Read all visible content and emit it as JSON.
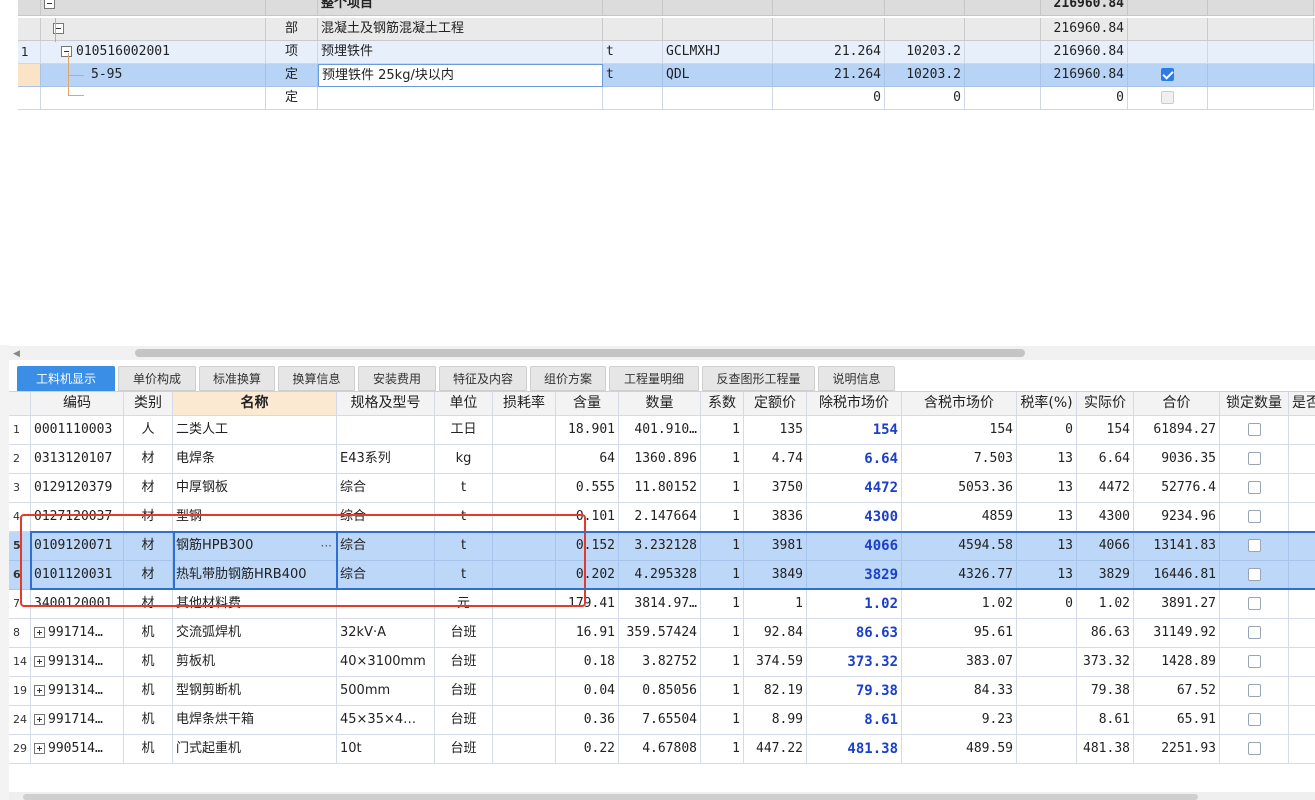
{
  "upper": {
    "rows": [
      {
        "kind": "head",
        "name": "整个项目",
        "total": "216960.84"
      },
      {
        "kind": "part",
        "type": "部",
        "name": "混凝土及钢筋混凝土工程",
        "total": "216960.84"
      },
      {
        "kind": "item",
        "idx": "1",
        "code": "010516002001",
        "type": "项",
        "name": "预埋铁件",
        "unit": "t",
        "expr": "GCLMXHJ",
        "qty": "21.264",
        "price": "10203.2",
        "total": "216960.84",
        "extra": "预"
      },
      {
        "kind": "sel",
        "code": "5-95",
        "type": "定",
        "name": "预埋铁件 25kg/块以内",
        "unit": "t",
        "expr": "QDL",
        "qty": "21.264",
        "price": "10203.2",
        "total": "216960.84",
        "checked": true
      },
      {
        "kind": "empty",
        "type": "定",
        "qty": "0",
        "price": "0",
        "total": "0"
      }
    ]
  },
  "tabs": [
    "工料机显示",
    "单价构成",
    "标准换算",
    "换算信息",
    "安装费用",
    "特征及内容",
    "组价方案",
    "工程量明细",
    "反查图形工程量",
    "说明信息"
  ],
  "active_tab": 0,
  "lower": {
    "headers": [
      "编码",
      "类别",
      "名称",
      "规格及型号",
      "单位",
      "损耗率",
      "含量",
      "数量",
      "系数",
      "定额价",
      "除税市场价",
      "含税市场价",
      "税率(%)",
      "实际价",
      "合价",
      "锁定数量",
      "是否"
    ],
    "rows": [
      {
        "rn": "1",
        "code": "0001110003",
        "cat": "人",
        "name": "二类人工",
        "spec": "",
        "unit": "工日",
        "loss": "",
        "content": "18.901",
        "qty": "401.910…",
        "coef": "1",
        "base": "135",
        "net": "154",
        "gross": "154",
        "tax": "0",
        "actual": "154",
        "sum": "61894.27",
        "expand": false,
        "sel": false
      },
      {
        "rn": "2",
        "code": "0313120107",
        "cat": "材",
        "name": "电焊条",
        "spec": "E43系列",
        "unit": "kg",
        "loss": "",
        "content": "64",
        "qty": "1360.896",
        "coef": "1",
        "base": "4.74",
        "net": "6.64",
        "gross": "7.503",
        "tax": "13",
        "actual": "6.64",
        "sum": "9036.35",
        "expand": false,
        "sel": false
      },
      {
        "rn": "3",
        "code": "0129120379",
        "cat": "材",
        "name": "中厚钢板",
        "spec": "综合",
        "unit": "t",
        "loss": "",
        "content": "0.555",
        "qty": "11.80152",
        "coef": "1",
        "base": "3750",
        "net": "4472",
        "gross": "5053.36",
        "tax": "13",
        "actual": "4472",
        "sum": "52776.4",
        "expand": false,
        "sel": false
      },
      {
        "rn": "4",
        "code": "0127120037",
        "cat": "材",
        "name": "型钢",
        "spec": "综合",
        "unit": "t",
        "loss": "",
        "content": "0.101",
        "qty": "2.147664",
        "coef": "1",
        "base": "3836",
        "net": "4300",
        "gross": "4859",
        "tax": "13",
        "actual": "4300",
        "sum": "9234.96",
        "expand": false,
        "sel": false
      },
      {
        "rn": "5",
        "code": "0109120071",
        "cat": "材",
        "name": "钢筋HPB300",
        "spec": "综合",
        "unit": "t",
        "loss": "",
        "content": "0.152",
        "qty": "3.232128",
        "coef": "1",
        "base": "3981",
        "net": "4066",
        "gross": "4594.58",
        "tax": "13",
        "actual": "4066",
        "sum": "13141.83",
        "expand": false,
        "sel": true,
        "ellipsis": "···"
      },
      {
        "rn": "6",
        "code": "0101120031",
        "cat": "材",
        "name": "热轧带肋钢筋HRB400",
        "spec": "综合",
        "unit": "t",
        "loss": "",
        "content": "0.202",
        "qty": "4.295328",
        "coef": "1",
        "base": "3849",
        "net": "3829",
        "gross": "4326.77",
        "tax": "13",
        "actual": "3829",
        "sum": "16446.81",
        "expand": false,
        "sel": true
      },
      {
        "rn": "7",
        "code": "3400120001",
        "cat": "材",
        "name": "其他材料费",
        "spec": "",
        "unit": "元",
        "loss": "",
        "content": "179.41",
        "qty": "3814.97…",
        "coef": "1",
        "base": "1",
        "net": "1.02",
        "gross": "1.02",
        "tax": "0",
        "actual": "1.02",
        "sum": "3891.27",
        "expand": false,
        "sel": false
      },
      {
        "rn": "8",
        "code": "991714…",
        "cat": "机",
        "name": "交流弧焊机",
        "spec": "32kV·A",
        "unit": "台班",
        "loss": "",
        "content": "16.91",
        "qty": "359.57424",
        "coef": "1",
        "base": "92.84",
        "net": "86.63",
        "gross": "95.61",
        "tax": "",
        "actual": "86.63",
        "sum": "31149.92",
        "expand": true,
        "sel": false
      },
      {
        "rn": "14",
        "code": "991314…",
        "cat": "机",
        "name": "剪板机",
        "spec": "40×3100mm",
        "unit": "台班",
        "loss": "",
        "content": "0.18",
        "qty": "3.82752",
        "coef": "1",
        "base": "374.59",
        "net": "373.32",
        "gross": "383.07",
        "tax": "",
        "actual": "373.32",
        "sum": "1428.89",
        "expand": true,
        "sel": false
      },
      {
        "rn": "19",
        "code": "991314…",
        "cat": "机",
        "name": "型钢剪断机",
        "spec": "500mm",
        "unit": "台班",
        "loss": "",
        "content": "0.04",
        "qty": "0.85056",
        "coef": "1",
        "base": "82.19",
        "net": "79.38",
        "gross": "84.33",
        "tax": "",
        "actual": "79.38",
        "sum": "67.52",
        "expand": true,
        "sel": false
      },
      {
        "rn": "24",
        "code": "991714…",
        "cat": "机",
        "name": "电焊条烘干箱",
        "spec": "45×35×4…",
        "unit": "台班",
        "loss": "",
        "content": "0.36",
        "qty": "7.65504",
        "coef": "1",
        "base": "8.99",
        "net": "8.61",
        "gross": "9.23",
        "tax": "",
        "actual": "8.61",
        "sum": "65.91",
        "expand": true,
        "sel": false
      },
      {
        "rn": "29",
        "code": "990514…",
        "cat": "机",
        "name": "门式起重机",
        "spec": "10t",
        "unit": "台班",
        "loss": "",
        "content": "0.22",
        "qty": "4.67808",
        "coef": "1",
        "base": "447.22",
        "net": "481.38",
        "gross": "489.59",
        "tax": "",
        "actual": "481.38",
        "sum": "2251.93",
        "expand": true,
        "sel": false
      }
    ]
  },
  "colors": {
    "selected_row": "#bcd7f7",
    "active_tab": "#3a8ee6",
    "price_text": "#1a3fc9",
    "annotation_box": "#e23b2e"
  }
}
